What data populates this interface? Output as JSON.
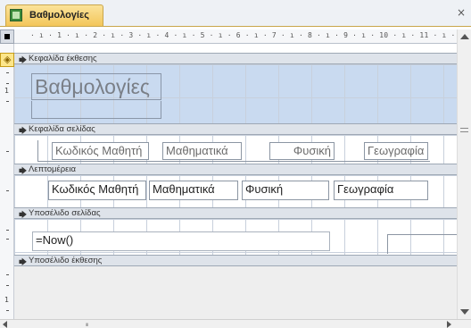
{
  "window": {
    "tab_title": "Βαθμολογίες",
    "close_glyph": "×",
    "tab_icon": "report-icon"
  },
  "ruler": {
    "labels": "· ı · 1 · ı · 2 · ı · 3 · ı · 4 · ı · 5 · ı · 6 · ı · 7 · ı · 8 · ı · 9 · ı · 10 · ı · 11 · ı · 12 · ı ·"
  },
  "vertical_ruler": {
    "numbers": [
      "1",
      "1"
    ]
  },
  "sections": {
    "report_header": "Κεφαλίδα έκθεσης",
    "page_header": "Κεφαλίδα σελίδας",
    "detail": "Λεπτομέρεια",
    "page_footer": "Υποσέλιδο σελίδας",
    "report_footer": "Υποσέλιδο έκθεσης"
  },
  "report_header_controls": {
    "title": "Βαθμολογίες"
  },
  "page_header_controls": {
    "student_code_label": "Κωδικός Μαθητή",
    "math_label": "Μαθηματικά",
    "physics_label": "Φυσική",
    "geography_label": "Γεωγραφία"
  },
  "detail_controls": {
    "student_code_field": "Κωδικός Μαθητή",
    "math_field": "Μαθηματικά",
    "physics_field": "Φυσική",
    "geography_field": "Γεωγραφία"
  },
  "page_footer_controls": {
    "date_expression": "=Now()"
  },
  "scrollbar": {
    "h_grip": "ııı"
  },
  "colors": {
    "tab_active": "#f3c65a",
    "section_bar": "#dee3ea",
    "grid_blue": "#c9daf0",
    "selector_yellow": "#fde68a"
  }
}
